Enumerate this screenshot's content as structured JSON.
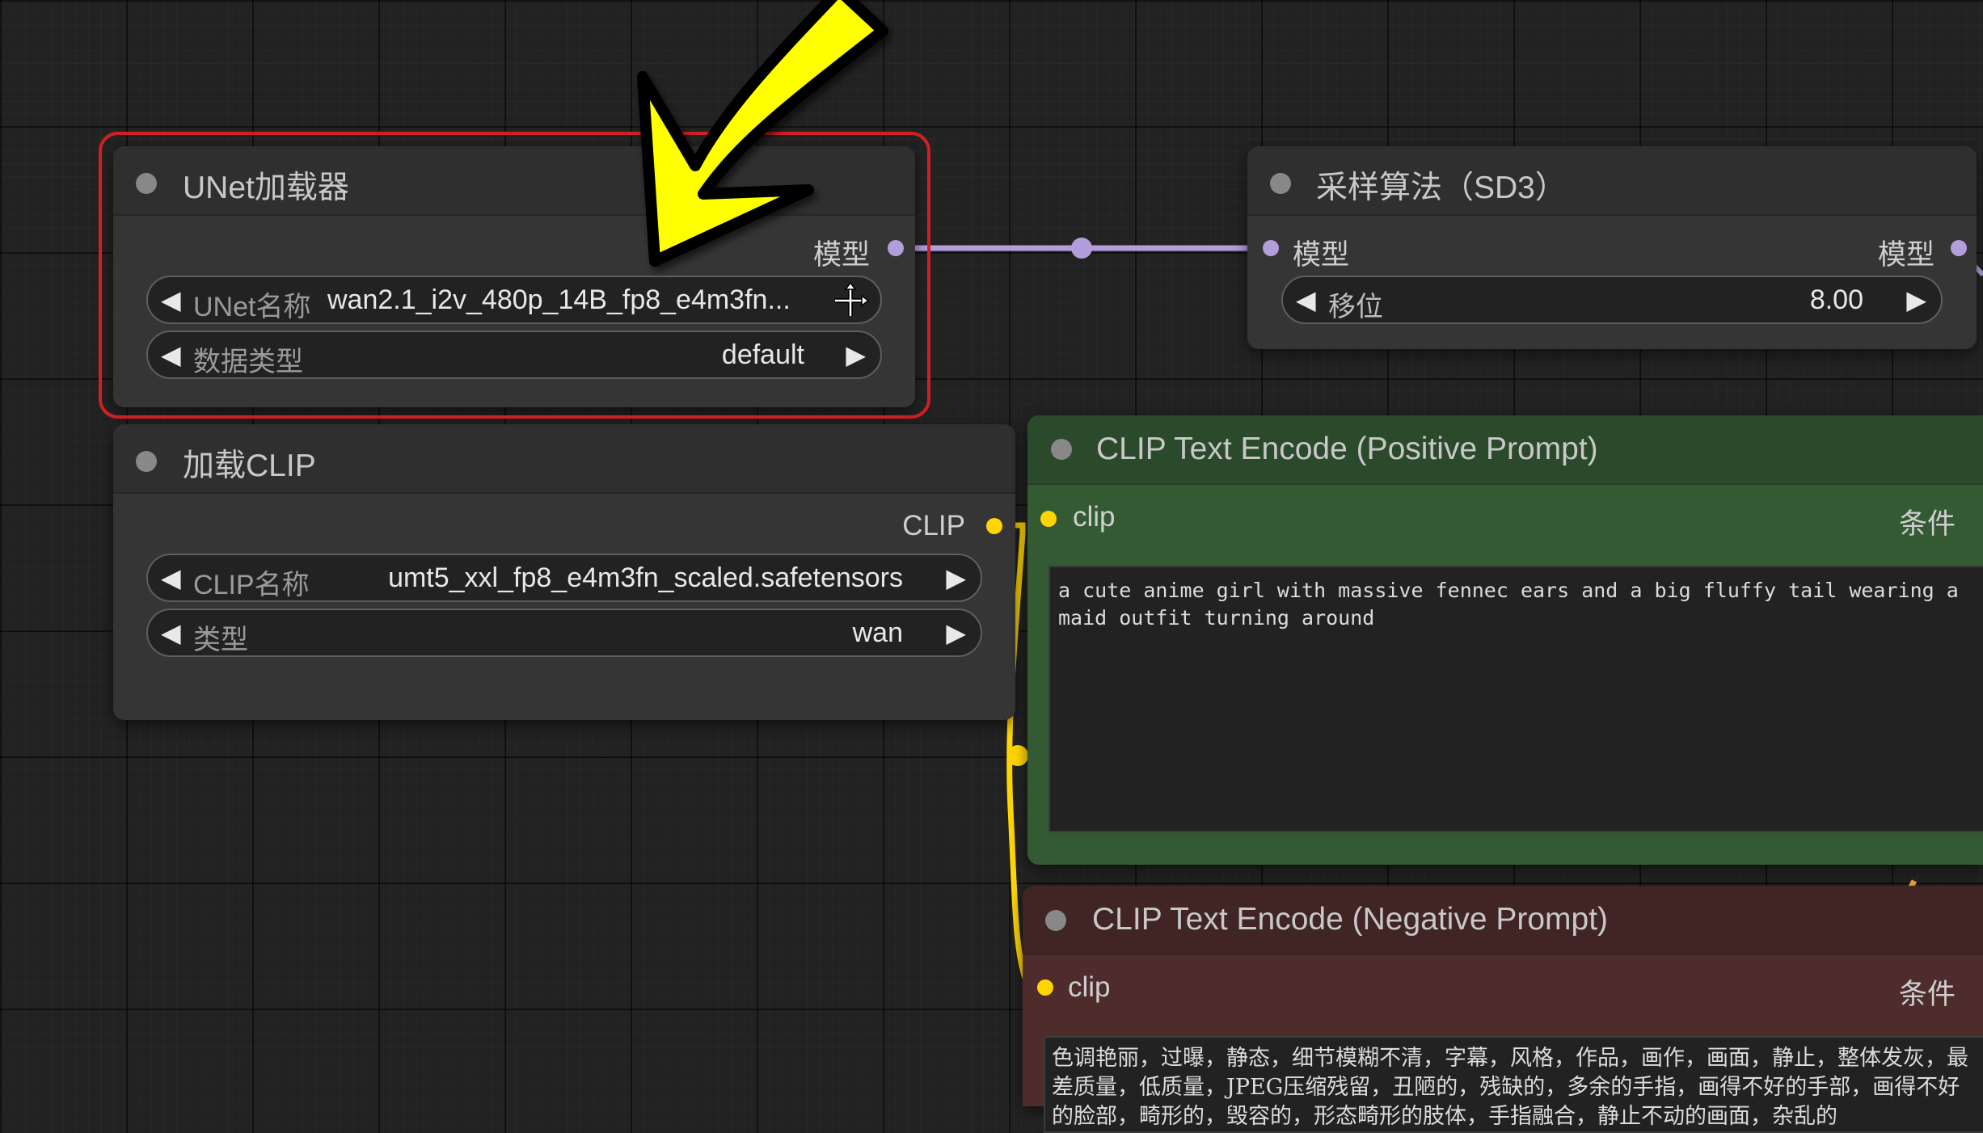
{
  "colors": {
    "canvas_bg": "#222222",
    "node_bg": "#353535",
    "node_header_bg": "#2f2f2f",
    "positive_node_bg": "#345a34",
    "positive_header_bg": "#2b4a2b",
    "negative_node_bg": "#4f2c2c",
    "negative_header_bg": "#412424",
    "model_link": "#b39ddb",
    "clip_link": "#ffd500",
    "conditioning_link": "#ffa931",
    "highlight_border": "#d11f26",
    "annotation_arrow": "#ffff00"
  },
  "nodes": {
    "unet_loader": {
      "title": "UNet加载器",
      "output_label": "模型",
      "widgets": [
        {
          "label": "UNet名称",
          "value": "wan2.1_i2v_480p_14B_fp8_e4m3fn..."
        },
        {
          "label": "数据类型",
          "value": "default"
        }
      ]
    },
    "sampling_sd3": {
      "title": "采样算法（SD3）",
      "input_label": "模型",
      "output_label": "模型",
      "widgets": [
        {
          "label": "移位",
          "value": "8.00"
        }
      ]
    },
    "clip_loader": {
      "title": "加载CLIP",
      "output_label": "CLIP",
      "widgets": [
        {
          "label": "CLIP名称",
          "value": "umt5_xxl_fp8_e4m3fn_scaled.safetensors"
        },
        {
          "label": "类型",
          "value": "wan"
        }
      ]
    },
    "clip_positive": {
      "title": "CLIP Text Encode (Positive Prompt)",
      "input_label": "clip",
      "output_label": "条件",
      "text": "a cute anime girl with massive fennec ears and a big fluffy tail wearing a maid outfit turning around"
    },
    "clip_negative": {
      "title": "CLIP Text Encode (Negative Prompt)",
      "input_label": "clip",
      "output_label": "条件",
      "text": "色调艳丽，过曝，静态，细节模糊不清，字幕，风格，作品，画作，画面，静止，整体发灰，最差质量，低质量，JPEG压缩残留，丑陋的，残缺的，多余的手指，画得不好的手部，画得不好的脸部，畸形的，毁容的，形态畸形的肢体，手指融合，静止不动的画面，杂乱的"
    }
  }
}
